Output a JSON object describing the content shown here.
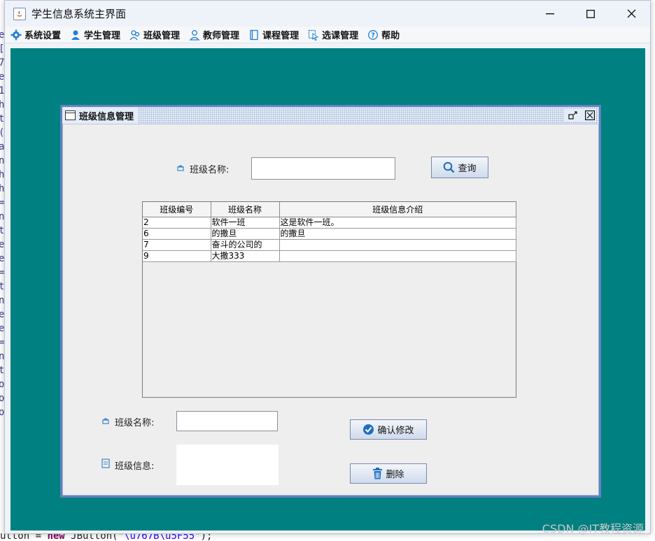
{
  "background_code": {
    "left_fragments": [
      "e",
      "[",
      "7",
      "e(",
      "1",
      "he",
      "tB",
      "((",
      "at",
      "n",
      "he",
      "he",
      "=",
      "nt",
      "t(",
      "e",
      "e",
      "=",
      "t",
      "n",
      "e",
      "e",
      "=",
      "n",
      "t",
      "o",
      "o",
      "o"
    ],
    "bottom_line": {
      "prefix": "utton = ",
      "keyword": "new",
      "call": " JButton(",
      "string": "\"\\u767B\\u5F55\"",
      "suffix": ");"
    }
  },
  "window": {
    "title": "学生信息系统主界面",
    "minimize": "—",
    "maximize": "☐",
    "close": "✕"
  },
  "menu": [
    {
      "label": "系统设置",
      "icon": "gear-icon"
    },
    {
      "label": "学生管理",
      "icon": "student-icon"
    },
    {
      "label": "班级管理",
      "icon": "class-icon"
    },
    {
      "label": "教师管理",
      "icon": "teacher-icon"
    },
    {
      "label": "课程管理",
      "icon": "course-icon"
    },
    {
      "label": "选课管理",
      "icon": "select-course-icon"
    },
    {
      "label": "帮助",
      "icon": "help-icon"
    }
  ],
  "class_frame": {
    "title": "班级信息管理",
    "search": {
      "label": "班级名称:",
      "value": "",
      "button": "查询"
    },
    "table": {
      "columns": [
        "班级编号",
        "班级名称",
        "班级信息介绍"
      ],
      "rows": [
        [
          "2",
          "软件一班",
          "这是软件一班。"
        ],
        [
          "6",
          "的撒旦",
          "的撒旦"
        ],
        [
          "7",
          "奋斗的公司的",
          ""
        ],
        [
          "9",
          "大撒333",
          ""
        ]
      ]
    },
    "edit": {
      "name_label": "班级名称:",
      "name_value": "",
      "info_label": "班级信息:",
      "info_value": "",
      "confirm_button": "确认修改",
      "delete_button": "删除"
    }
  },
  "watermark": "CSDN @IT教程资源",
  "colors": {
    "desktop": "#008080",
    "frame_border": "#6382bf",
    "accent_icon": "#1f7fd6"
  }
}
